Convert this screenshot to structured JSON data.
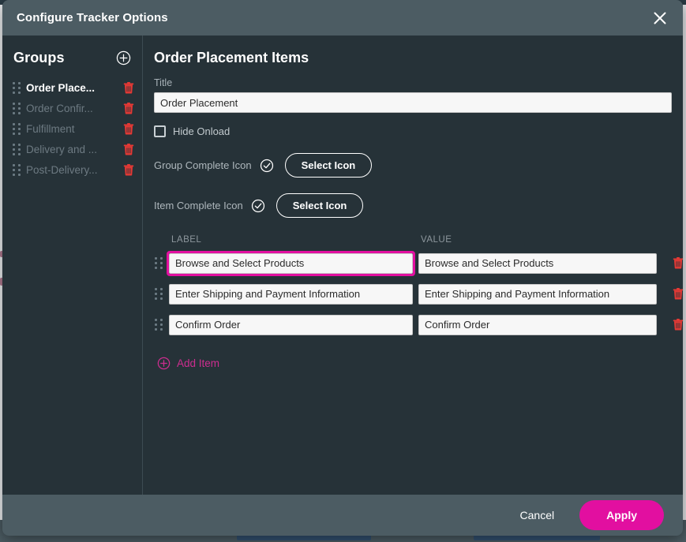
{
  "dialog": {
    "title": "Configure Tracker Options",
    "close_icon": "close-icon"
  },
  "sidebar": {
    "heading": "Groups",
    "add_icon": "plus-circle-icon",
    "items": [
      {
        "label": "Order Place...",
        "active": true,
        "delete_icon": "trash-icon",
        "drag_icon": "drag-handle-icon"
      },
      {
        "label": "Order Confir...",
        "active": false,
        "delete_icon": "trash-icon",
        "drag_icon": "drag-handle-icon"
      },
      {
        "label": "Fulfillment",
        "active": false,
        "delete_icon": "trash-icon",
        "drag_icon": "drag-handle-icon"
      },
      {
        "label": "Delivery and ...",
        "active": false,
        "delete_icon": "trash-icon",
        "drag_icon": "drag-handle-icon"
      },
      {
        "label": "Post-Delivery...",
        "active": false,
        "delete_icon": "trash-icon",
        "drag_icon": "drag-handle-icon"
      }
    ]
  },
  "main": {
    "heading": "Order Placement Items",
    "title_field": {
      "label": "Title",
      "value": "Order Placement",
      "placeholder": "Title"
    },
    "hide_onload": {
      "label": "Hide Onload",
      "checked": false
    },
    "group_complete_icon": {
      "label": "Group Complete Icon",
      "current_icon": "check-circle-icon",
      "button_label": "Select Icon"
    },
    "item_complete_icon": {
      "label": "Item Complete Icon",
      "current_icon": "check-circle-icon",
      "button_label": "Select Icon"
    },
    "items_table": {
      "columns": [
        "LABEL",
        "VALUE"
      ],
      "rows": [
        {
          "label": "Browse and Select Products",
          "value": "Browse and Select Products",
          "focused": true,
          "delete_icon": "trash-icon",
          "drag_icon": "drag-handle-icon"
        },
        {
          "label": "Enter Shipping and Payment Information",
          "value": "Enter Shipping and Payment Information",
          "focused": false,
          "delete_icon": "trash-icon",
          "drag_icon": "drag-handle-icon"
        },
        {
          "label": "Confirm Order",
          "value": "Confirm Order",
          "focused": false,
          "delete_icon": "trash-icon",
          "drag_icon": "drag-handle-icon"
        }
      ]
    },
    "add_item": {
      "label": "Add Item",
      "icon": "plus-circle-icon"
    }
  },
  "footer": {
    "cancel_label": "Cancel",
    "apply_label": "Apply"
  },
  "colors": {
    "accent_magenta": "#e20fa0",
    "link_magenta": "#cc2d8f",
    "danger_red": "#e53935",
    "dialog_body": "#263238",
    "dialog_chrome": "#4c5c63"
  }
}
